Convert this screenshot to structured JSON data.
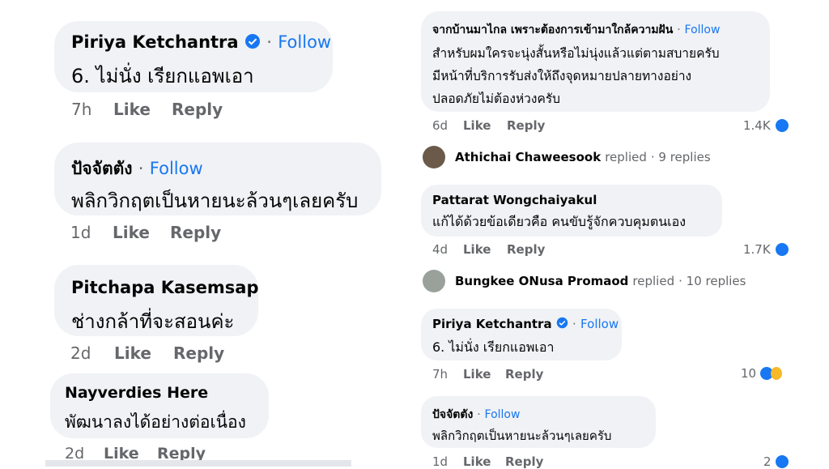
{
  "left_comments": [
    {
      "author": "Piriya Ketchantra",
      "verified": true,
      "follow": "Follow",
      "text": "6. ไม่นั่ง เรียกแอพเอา",
      "time": "7h",
      "like": "Like",
      "reply": "Reply"
    },
    {
      "author": "ปัจจัตตัง",
      "verified": false,
      "follow": "Follow",
      "text": "พลิกวิกฤตเป็นหายนะล้วนๆเลยครับ",
      "time": "1d",
      "like": "Like",
      "reply": "Reply"
    },
    {
      "author": "Pitchapa Kasemsap",
      "verified": false,
      "follow": "",
      "text": "ช่างกล้าที่จะสอนค่ะ",
      "time": "2d",
      "like": "Like",
      "reply": "Reply"
    },
    {
      "author": "Nayverdies Here",
      "verified": false,
      "follow": "",
      "text": "พัฒนาลงได้อย่างต่อเนื่อง",
      "time": "2d",
      "like": "Like",
      "reply": "Reply"
    }
  ],
  "right_comments": [
    {
      "author": "จากบ้านมาไกล เพราะต้องการเข้ามาใกล้ความฝัน",
      "follow": "Follow",
      "text_lines": [
        "สำหรับผมใครจะนุ่งสั้นหรือไม่นุ่งแล้วแต่ตามสบายครับ",
        "มีหน้าที่บริการรับส่งให้ถึงจุดหมายปลายทางอย่าง",
        "ปลอดภัยไม่ต้องห่วงครับ"
      ],
      "time": "6d",
      "like": "Like",
      "reply": "Reply",
      "reactions": "1.4K"
    },
    {
      "author": "Pattarat Wongchaiyakul",
      "follow": "",
      "text_lines": [
        "แก้ได้ด้วยข้อเดียวคือ คนขับรู้จักควบคุมตนเอง"
      ],
      "time": "4d",
      "like": "Like",
      "reply": "Reply",
      "reactions": "1.7K"
    },
    {
      "author": "Piriya Ketchantra",
      "follow": "Follow",
      "verified": true,
      "text_lines": [
        "6. ไม่นั่ง เรียกแอพเอา"
      ],
      "time": "7h",
      "like": "Like",
      "reply": "Reply",
      "reactions": "10"
    },
    {
      "author": "ปัจจัตตัง",
      "follow": "Follow",
      "text_lines": [
        "พลิกวิกฤตเป็นหายนะล้วนๆเลยครับ"
      ],
      "time": "1d",
      "like": "Like",
      "reply": "Reply",
      "reactions": "2"
    }
  ],
  "reply_threads": [
    {
      "name": "Athichai Chaweesook",
      "replied": "replied",
      "count": "· 9 replies"
    },
    {
      "name": "Bungkee ONusa Promaod",
      "replied": "replied",
      "count": "· 10 replies"
    }
  ],
  "separator": "·",
  "colors": {
    "bubble": "#f0f2f5",
    "link": "#1877f2",
    "meta": "#65676b"
  }
}
